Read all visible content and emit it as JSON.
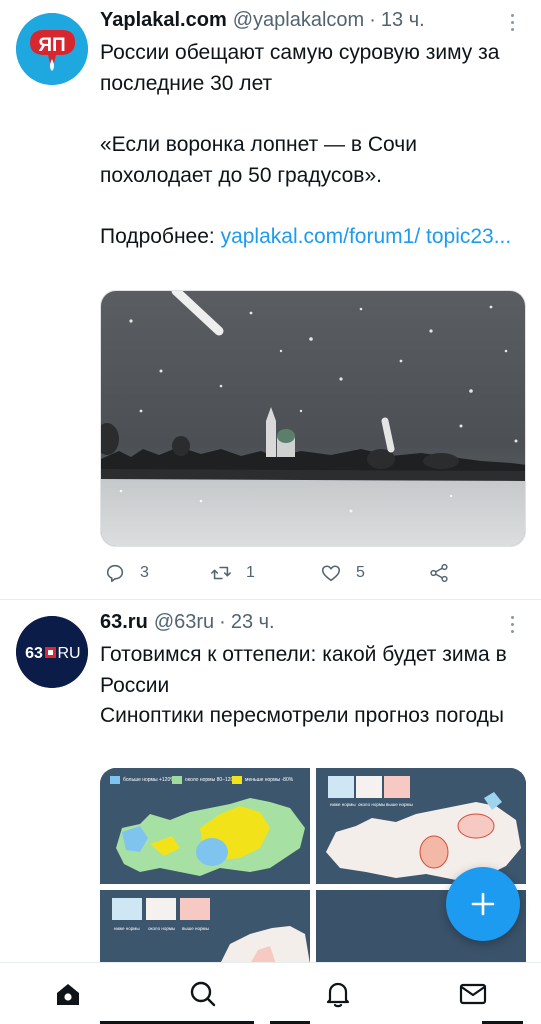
{
  "tweets": [
    {
      "name": "Yaplakal.com",
      "handle": "@yaplakalcom",
      "dot": "·",
      "time": "13 ч.",
      "avatar_text": "ЯП",
      "text_line1": "России обещают самую суровую зиму за последние 30 лет",
      "text_line2": "«Если воронка лопнет — в Сочи похолодает до 50 градусов».",
      "text_prefix": "Подробнее: ",
      "text_link": "yaplakal.com/forum1/ topic23...",
      "media_description": "snowy winter landscape with church",
      "counts": {
        "replies": "3",
        "retweets": "1",
        "likes": "5"
      }
    },
    {
      "name": "63.ru",
      "handle": "@63ru",
      "dot": "·",
      "time": "23 ч.",
      "avatar_text_left": "63",
      "avatar_text_right": "RU",
      "text_line1": "Готовимся к оттепели: какой будет зима в России",
      "text_line2": "Синоптики пересмотрели прогноз погоды",
      "maps": {
        "legend_1": "больше нормы +120%",
        "legend_2": "около нормы 80–120%",
        "legend_3": "меньше нормы -80%",
        "bar_1": "ниже нормы",
        "bar_2": "около нормы",
        "bar_3": "выше нормы"
      }
    }
  ],
  "colors": {
    "accent": "#1d9bf0",
    "text": "#0f1419",
    "secondary": "#536471",
    "divider": "#e6ecf0"
  },
  "nav": {
    "items": [
      "home-icon",
      "search-icon",
      "notifications-icon",
      "messages-icon"
    ]
  },
  "fab": {
    "icon": "plus-icon"
  }
}
